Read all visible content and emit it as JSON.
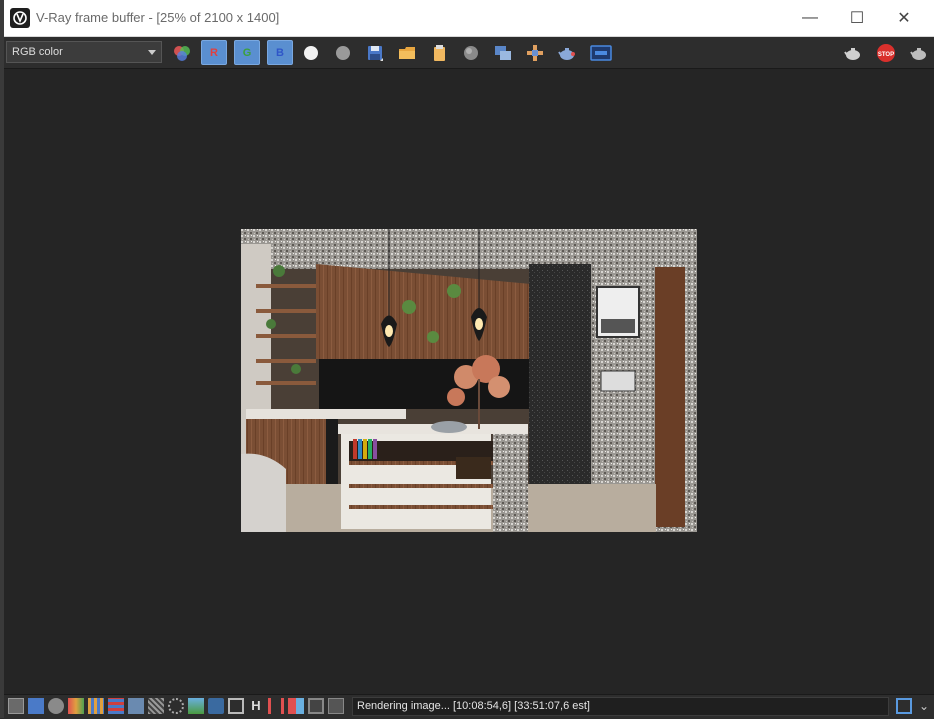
{
  "window": {
    "title": "V-Ray frame buffer - [25% of 2100 x 1400]",
    "minimize_glyph": "—",
    "maximize_glyph": "☐",
    "close_glyph": "✕"
  },
  "toolbar": {
    "channel_select_value": "RGB color",
    "red_channel_label": "R",
    "green_channel_label": "G",
    "blue_channel_label": "B",
    "stop_label": "STOP"
  },
  "status": {
    "text": "Rendering image... [10:08:54,6] [33:51:07,6 est]"
  },
  "colors": {
    "accent_blue": "#5a8fd0",
    "stop_red": "#d9302c",
    "toolbar_bg": "#2d2d2d",
    "viewport_bg": "#252525"
  }
}
